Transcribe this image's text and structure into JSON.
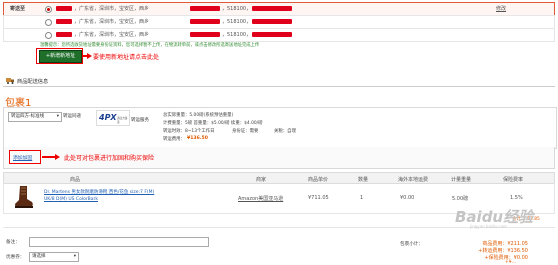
{
  "address": {
    "selected_tag": "寄送至",
    "rows": [
      {
        "region": "，广东省，深圳市，宝安区，西乡",
        "postcode": "，518100，",
        "edit": "修改"
      },
      {
        "region": "，广东省，深圳市，宝安区，西乡",
        "postcode": "，518100，"
      },
      {
        "region": "，广东省，深圳市，宝安区，西乡",
        "postcode": "，518100，"
      }
    ],
    "notice": "温馨提示：您所选收货地址需要身份证资料，您可选择暂不上传，在物流转单前，或点击修改所选寄送地址完成上传",
    "new_button": "+新增新地址",
    "new_annotation": "要使用新地址请点击此处"
  },
  "section_title": "商品配送信息",
  "parcel": {
    "title": "包裹1",
    "route_select": "转运四方-标准线",
    "route_mode": "转运同递",
    "logo_text": "4PX",
    "logo_sub": "递四方速递",
    "service": "转运服务",
    "est_weight": "总实际重量：5.00磅(系统预估重量)",
    "billing": "计费重量：5磅 首重量：$5.00/磅 续重：$4.00/磅",
    "eta_label": "转运时效：8~13个工作日",
    "id_card": "身份证：需要",
    "tax": "关税：自理",
    "fee_label": "转运费用：",
    "fee_value": "¥136.50"
  },
  "insure": {
    "link": "添加加固",
    "annotation": "此处可对包裹进行加固和购买保险"
  },
  "table": {
    "headers": [
      "商品",
      "商家",
      "商品单价",
      "数量",
      "海外本地运费",
      "计量重量",
      "保险费率"
    ],
    "rows": [
      {
        "name_line1": "Dr. Martens 男女款耐磨防滑靴 西色/花鱼 size:7 F(M)",
        "name_line2": "UK/8 D(M) US ColorBark",
        "merchant": "Amazon美国亚马逊",
        "price": "¥711.05",
        "qty": "1",
        "local_fee": "¥0.00",
        "weight": "5.00磅",
        "insurance": "1.5%"
      }
    ],
    "side_note": "合计 ... 11.85"
  },
  "footer": {
    "note_label": "备注：",
    "coupon_label": "优惠券：",
    "coupon_select": "请选择",
    "parcel_subtotal": "包裹小计：",
    "goods_total": "商品费用：¥211.05",
    "shipping_total": "+转运费用：¥136.50",
    "insurance_total": "+保险费用：¥0.00",
    "grand": "+¥..."
  },
  "watermark": "Baidu经验",
  "watermark_url": "jingyan.baidu.com",
  "colors": {
    "accent_red": "#e00000",
    "button_green": "#1f6e2a",
    "link_blue": "#1f5fb4",
    "price_red": "#e05a00"
  }
}
